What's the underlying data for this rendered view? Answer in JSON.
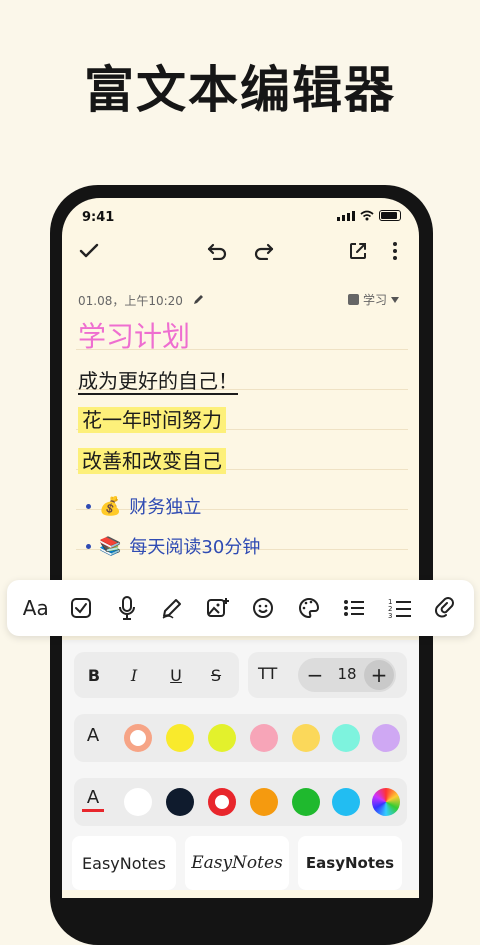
{
  "headline": "富文本编辑器",
  "status_bar": {
    "time": "9:41"
  },
  "top_toolbar": {
    "done_icon": "check-icon",
    "undo_icon": "undo-icon",
    "redo_icon": "redo-icon",
    "share_icon": "share-icon",
    "more_icon": "more-vertical-icon"
  },
  "note": {
    "meta": "01.08，上午10:20",
    "notebook": "学习",
    "title": "学习计划",
    "lines": [
      "成为更好的自己！",
      "花一年时间努力",
      "改善和改变自己"
    ],
    "bullets": [
      {
        "emoji": "💰",
        "text": "财务独立"
      },
      {
        "emoji": "📚",
        "text": "每天阅读30分钟"
      }
    ],
    "title_color": "#ee6ed0",
    "highlight_color": "#fdf07a",
    "bullet_color": "#2f4bb3"
  },
  "format_bar": {
    "font_label": "Aa",
    "items": [
      "font-icon",
      "checkbox-icon",
      "microphone-icon",
      "pen-icon",
      "image-add-icon",
      "emoji-icon",
      "palette-icon",
      "bullet-list-icon",
      "numbered-list-icon",
      "link-icon"
    ]
  },
  "style_panel": {
    "bold": "B",
    "italic": "I",
    "underline": "U",
    "strike": "S",
    "text_size_label": "TT",
    "minus": "−",
    "plus": "+",
    "font_size": "18",
    "highlight_colors": [
      "#f6a486",
      "#f9ea2c",
      "#e3f12c",
      "#f7a5b8",
      "#fbd85a",
      "#7ef3de",
      "#cfa8f3"
    ],
    "text_colors": [
      "#ffffff",
      "#0f1b2d",
      "#e8262c",
      "#f59a0f",
      "#1fb92e",
      "#22bdf2",
      "rainbow"
    ],
    "fonts": [
      "EasyNotes",
      "EasyNotes",
      "EasyNotes"
    ]
  }
}
